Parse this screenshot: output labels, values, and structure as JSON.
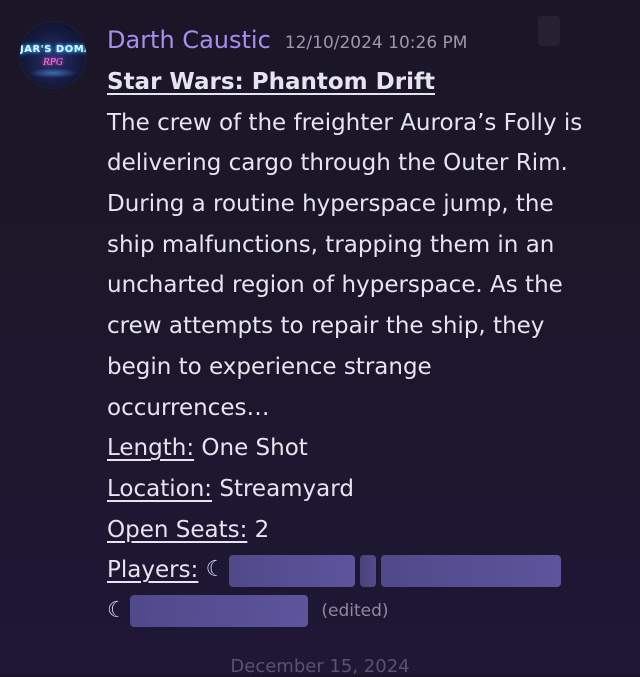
{
  "message": {
    "avatar": {
      "logo_text": "JAR'S DOMAIN",
      "logo_subtext": "RPG"
    },
    "author": "Darth Caustic",
    "timestamp": "12/10/2024 10:26 PM",
    "title": "Star Wars: Phantom Drift",
    "description_lines": [
      "The crew of the freighter Aurora’s Folly is",
      "delivering cargo through the Outer Rim.",
      "During a routine hyperspace jump, the",
      "ship malfunctions, trapping them in an",
      "uncharted region of hyperspace. As the",
      "crew attempts to repair the ship, they",
      "begin to experience strange",
      "occurrences…"
    ],
    "fields": {
      "length_label": "Length:",
      "length_value": "One Shot",
      "location_label": "Location:",
      "location_value": "Streamyard",
      "open_seats_label": "Open Seats:",
      "open_seats_value": "2",
      "players_label": "Players:"
    },
    "edited_label": "(edited)"
  },
  "divider": {
    "date_label": "December 15, 2024"
  },
  "colors": {
    "background": "#1c1729",
    "username": "#a98ef0",
    "timestamp": "#9c98ab",
    "text": "#e6e4ee",
    "mention": "#7f78d6"
  }
}
